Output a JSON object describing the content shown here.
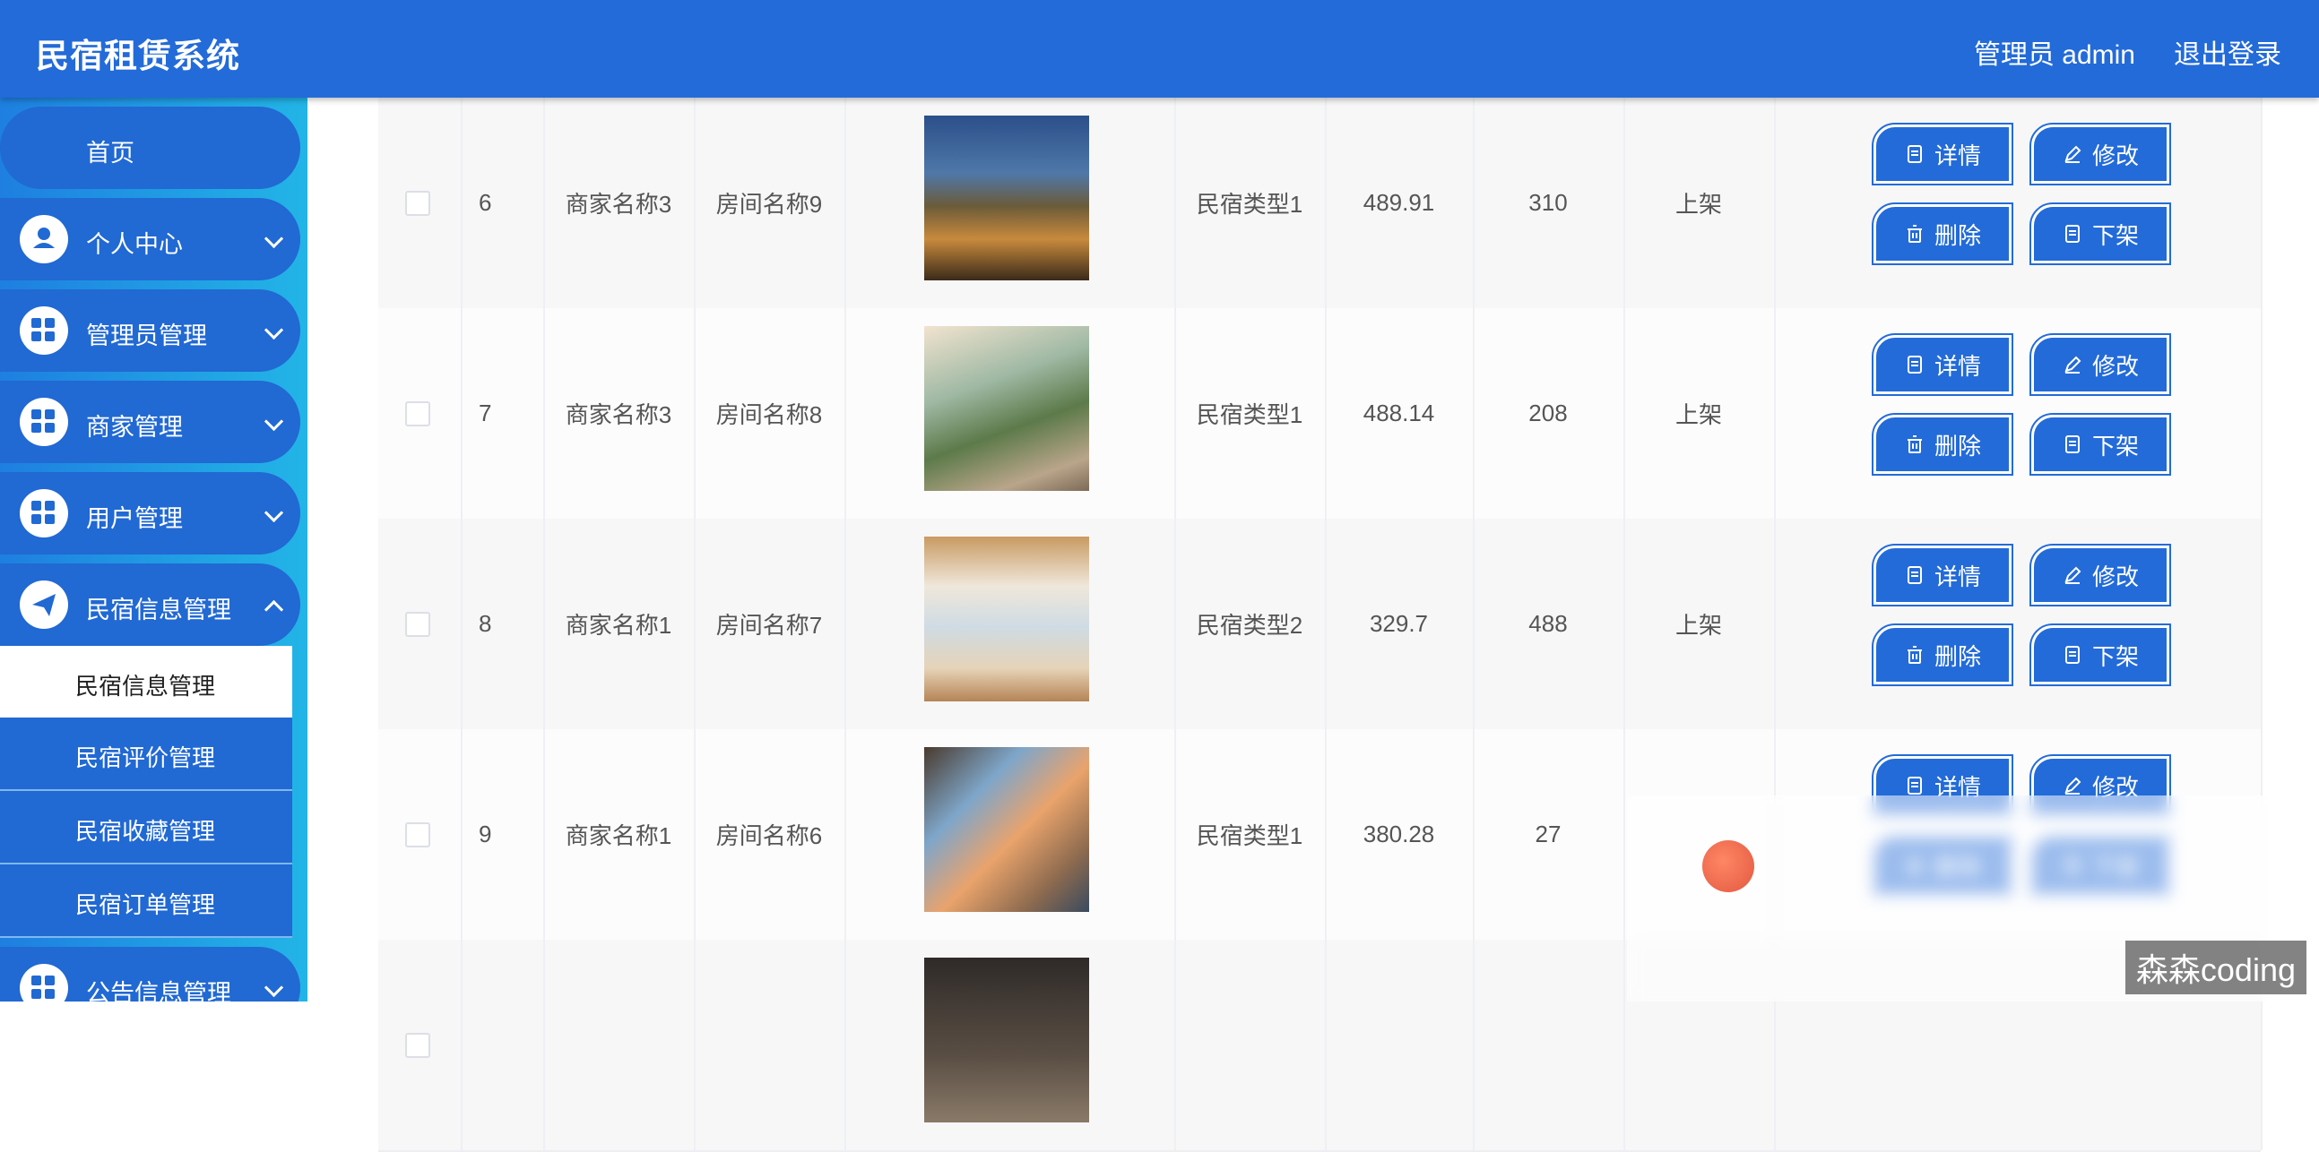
{
  "header": {
    "title": "民宿租赁系统",
    "user_label": "管理员 admin",
    "logout_label": "退出登录"
  },
  "sidebar": {
    "home": "首页",
    "items": [
      {
        "label": "个人中心",
        "icon": "user-icon"
      },
      {
        "label": "管理员管理",
        "icon": "grid-icon"
      },
      {
        "label": "商家管理",
        "icon": "grid-icon"
      },
      {
        "label": "用户管理",
        "icon": "grid-icon"
      },
      {
        "label": "民宿信息管理",
        "icon": "send-icon"
      }
    ],
    "subitems": [
      "民宿信息管理",
      "民宿评价管理",
      "民宿收藏管理",
      "民宿订单管理"
    ],
    "bottom_item": {
      "label": "公告信息管理",
      "icon": "grid-icon"
    }
  },
  "actions": {
    "detail": "详情",
    "edit": "修改",
    "delete": "删除",
    "offline": "下架"
  },
  "rows": [
    {
      "index": "6",
      "merchant": "商家名称3",
      "room": "房间名称9",
      "type": "民宿类型1",
      "price": "489.91",
      "count": "310",
      "status": "上架"
    },
    {
      "index": "7",
      "merchant": "商家名称3",
      "room": "房间名称8",
      "type": "民宿类型1",
      "price": "488.14",
      "count": "208",
      "status": "上架"
    },
    {
      "index": "8",
      "merchant": "商家名称1",
      "room": "房间名称7",
      "type": "民宿类型2",
      "price": "329.7",
      "count": "488",
      "status": "上架"
    },
    {
      "index": "9",
      "merchant": "商家名称1",
      "room": "房间名称6",
      "type": "民宿类型1",
      "price": "380.28",
      "count": "27",
      "status": ""
    }
  ],
  "watermark": "森森coding",
  "colors": {
    "primary": "#236bd8",
    "sidebar_gradient_start": "#1e7fe0",
    "sidebar_gradient_end": "#22b5e6"
  }
}
